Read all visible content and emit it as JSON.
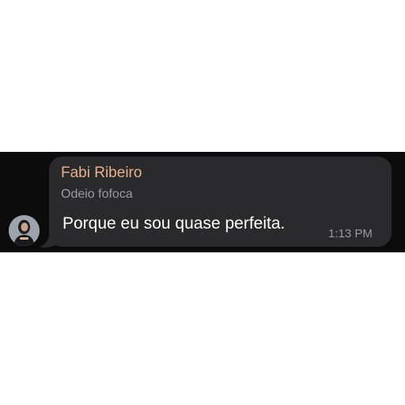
{
  "message": {
    "sender_name": "Fabi Ribeiro",
    "sender_status": "Odeio fofoca",
    "text": "Porque eu sou quase perfeita.",
    "time": "1:13 PM"
  },
  "icons": {
    "avatar": "user-avatar"
  },
  "colors": {
    "chat_background": "#0b0b0c",
    "bubble": "#2a2a2c",
    "sender_name": "#e7b08c",
    "message_text": "#ffffff",
    "secondary_text": "#9a9a9e"
  }
}
